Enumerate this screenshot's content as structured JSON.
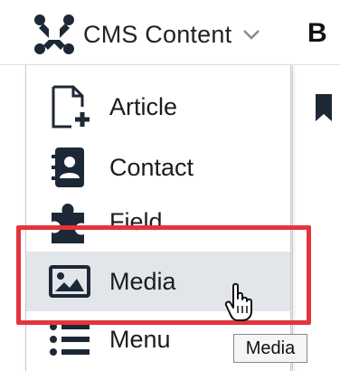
{
  "header": {
    "cms_label": "CMS Content",
    "next_menu_letter": "B"
  },
  "dropdown": {
    "items": [
      {
        "label": "Article",
        "icon": "file-plus-icon"
      },
      {
        "label": "Contact",
        "icon": "address-book-icon"
      },
      {
        "label": "Field",
        "icon": "puzzle-piece-icon"
      },
      {
        "label": "Media",
        "icon": "image-icon",
        "hovered": true
      },
      {
        "label": "Menu",
        "icon": "list-icon"
      }
    ]
  },
  "tooltip": {
    "text": "Media"
  },
  "colors": {
    "highlight_border": "#e3343d",
    "hover_background": "#e2e5ea",
    "icon_color": "#1d2836"
  }
}
